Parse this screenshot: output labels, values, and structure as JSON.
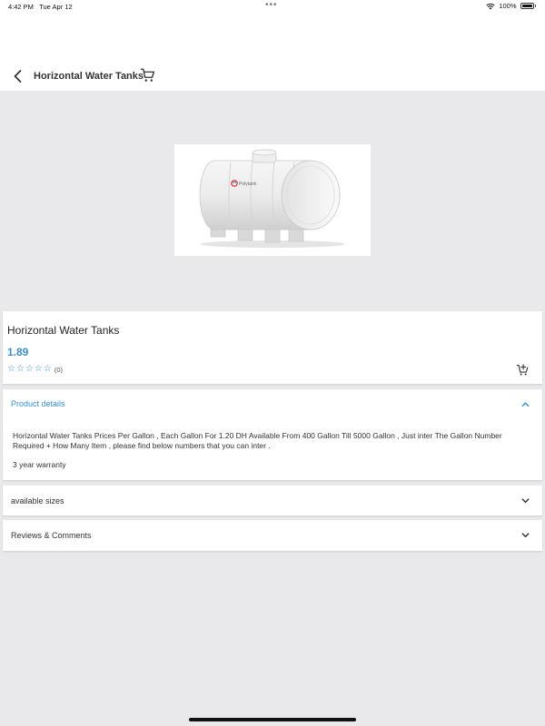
{
  "status_bar": {
    "time": "4:42 PM",
    "date": "Tue Apr 12",
    "battery": "100%",
    "more_dots": "•••"
  },
  "header": {
    "title": "Horizontal Water Tanks",
    "icons": [
      "back-arrow-icon",
      "cart-icon"
    ]
  },
  "product": {
    "image_alt": "Horizontal water tank",
    "brand_mark": "Polytank",
    "name": "Horizontal Water Tanks",
    "price": "1.89",
    "rating_stars": 0,
    "rating_count": "(0)"
  },
  "sections": {
    "details": {
      "title": "Product details",
      "expanded": true,
      "description": "Horizontal Water Tanks Prices Per Gallon ,  Each Gallon For 1.20 DH Available From 400 Gallon Till 5000 Gallon , Just inter The Gallon Number Required + How Many Item , please find below numbers that you can inter .",
      "warranty": "3 year warranty"
    },
    "sizes": {
      "title": "available sizes",
      "expanded": false
    },
    "reviews": {
      "title": "Reviews & Comments",
      "expanded": false
    }
  },
  "colors": {
    "accent": "#3a8fd1",
    "background": "#e9e9eb",
    "card": "#ffffff"
  }
}
